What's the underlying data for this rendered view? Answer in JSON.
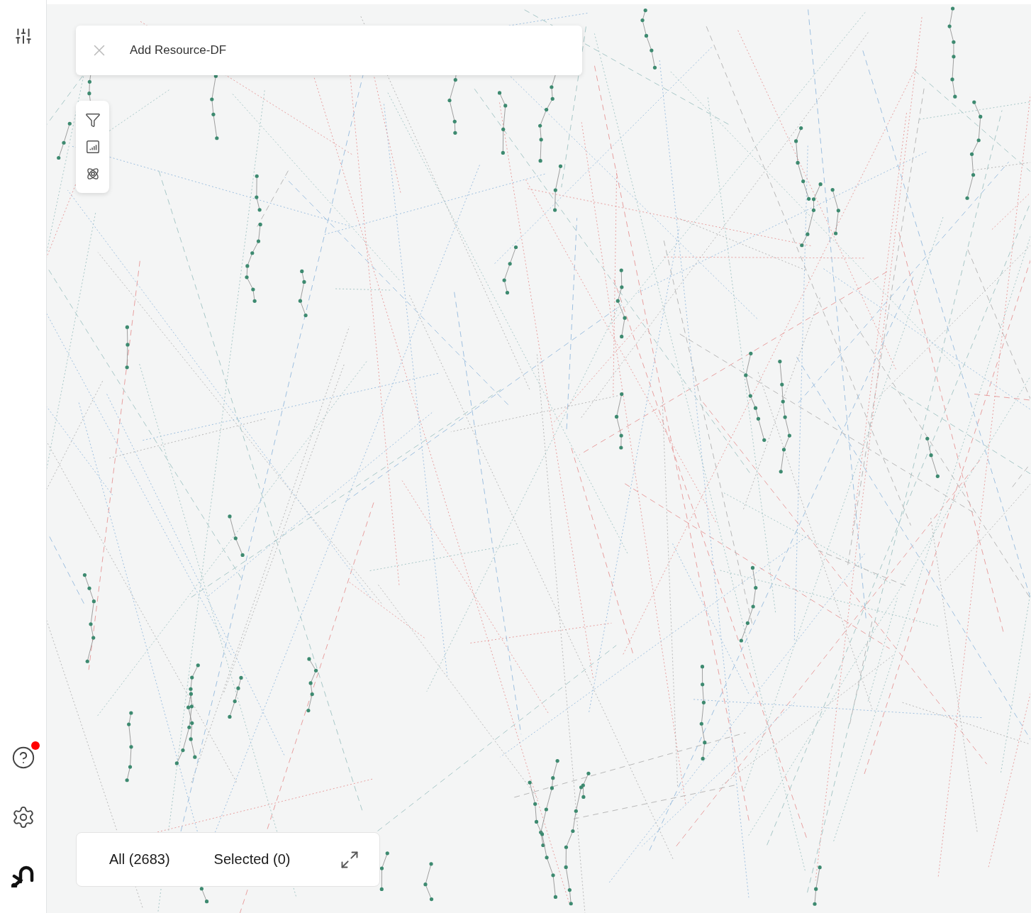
{
  "sidebar": {
    "help": {
      "has_notification": true
    }
  },
  "search": {
    "value": "Add Resource-DF"
  },
  "counts": [
    {
      "label": "All (2683)"
    },
    {
      "label": "Selected (0)"
    }
  ]
}
